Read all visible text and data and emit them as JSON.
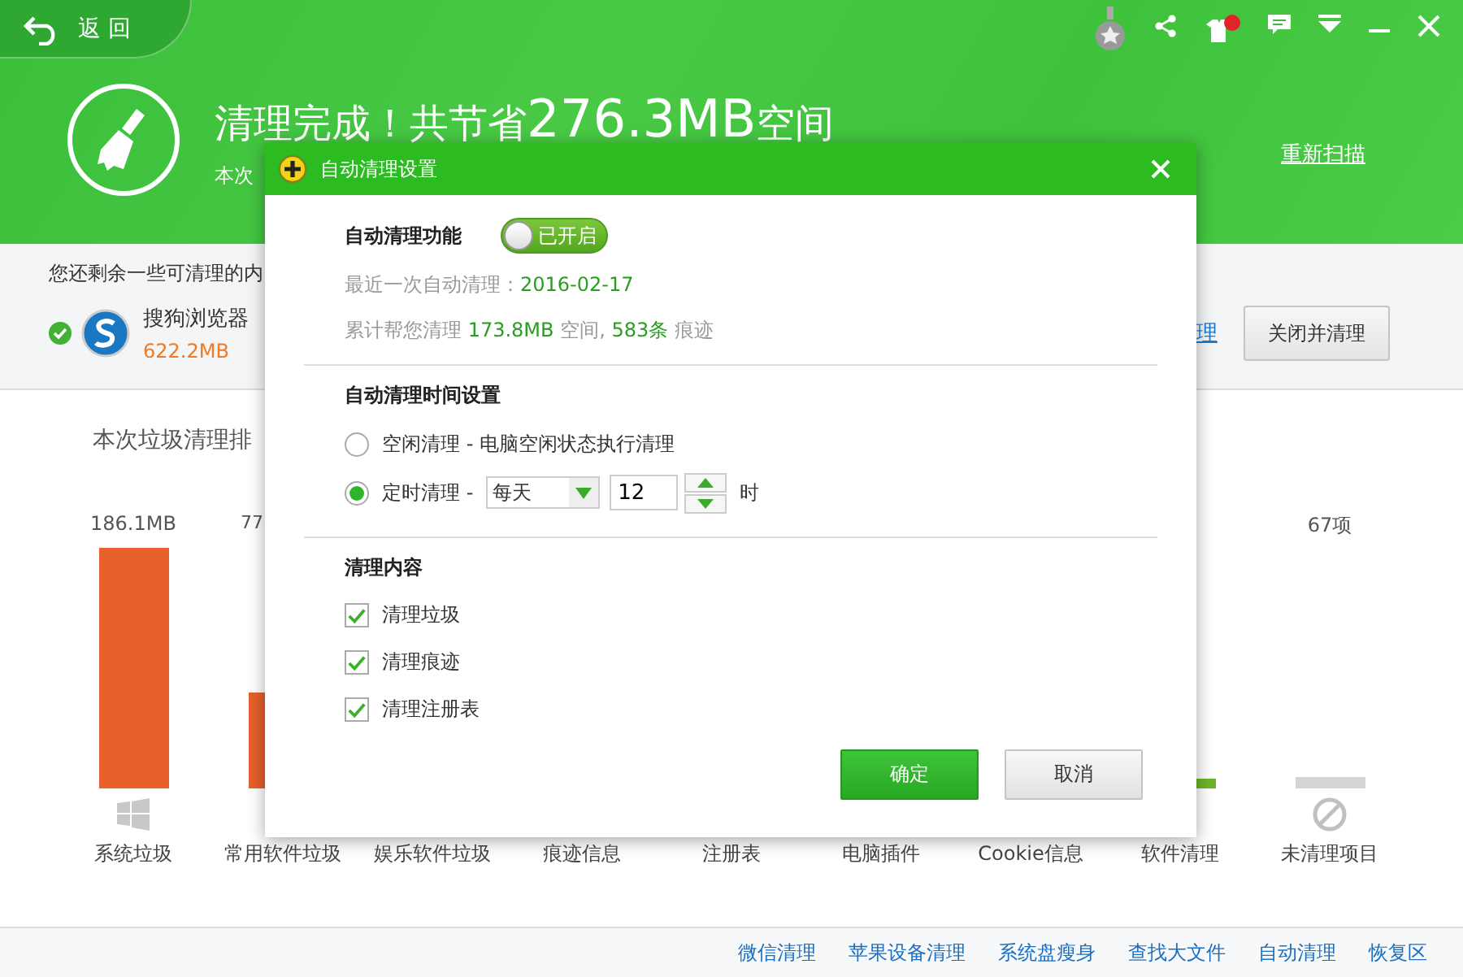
{
  "header": {
    "back": "返 回",
    "title": "清理完成！共节省",
    "amount": "276.3MB",
    "unit": "空间",
    "subtitle": "本次",
    "rescan": "重新扫描"
  },
  "remaining": {
    "notice": "您还剩余一些可清理的内",
    "app": {
      "name": "搜狗浏览器",
      "size": "622.2MB",
      "checked": true
    },
    "link": "理",
    "button": "关闭并清理"
  },
  "chart": {
    "title": "本次垃圾清理排",
    "columns": [
      {
        "kind": "system",
        "label": "系统垃圾",
        "value": "186.1MB",
        "level": 1,
        "color": "#e8602c"
      },
      {
        "kind": "partial",
        "label": "常用软件垃圾",
        "value": "77",
        "level": 0.4,
        "color": "#e8602c"
      },
      {
        "kind": "covered",
        "label": "娱乐软件垃圾"
      },
      {
        "kind": "covered",
        "label": "痕迹信息"
      },
      {
        "kind": "covered",
        "label": "注册表"
      },
      {
        "kind": "covered",
        "label": "电脑插件"
      },
      {
        "kind": "covered",
        "label": "Cookie信息"
      },
      {
        "kind": "software",
        "label": "软件清理",
        "level": 0.04,
        "color": "#6cb52a"
      },
      {
        "kind": "pending",
        "label": "未清理项目",
        "value": "67项",
        "level": 0.05,
        "color": "#d4d4d4"
      }
    ]
  },
  "footer": {
    "links": [
      "微信清理",
      "苹果设备清理",
      "系统盘瘦身",
      "查找大文件",
      "自动清理",
      "恢复区"
    ]
  },
  "dialog": {
    "title": "自动清理设置",
    "switch": {
      "label": "自动清理功能",
      "on": true,
      "text": "已开启"
    },
    "last_clean": {
      "label": "最近一次自动清理：",
      "value": "2016-02-17"
    },
    "total": [
      {
        "text": "累计帮您清理 ",
        "highlight": false
      },
      {
        "text": "173.8MB",
        "highlight": true
      },
      {
        "text": " 空间, ",
        "highlight": false
      },
      {
        "text": "583条",
        "highlight": true
      },
      {
        "text": " 痕迹",
        "highlight": false
      }
    ],
    "schedule_title": "自动清理时间设置",
    "modes": [
      {
        "label": "空闲清理 - 电脑空闲状态执行清理",
        "selected": false
      },
      {
        "label": "定时清理 -",
        "selected": true
      }
    ],
    "frequency": "每天",
    "hour": "12",
    "hour_unit": "时",
    "content_title": "清理内容",
    "options": [
      {
        "label": "清理垃圾",
        "checked": true
      },
      {
        "label": "清理痕迹",
        "checked": true
      },
      {
        "label": "清理注册表",
        "checked": true
      }
    ],
    "ok": "确定",
    "cancel": "取消"
  }
}
